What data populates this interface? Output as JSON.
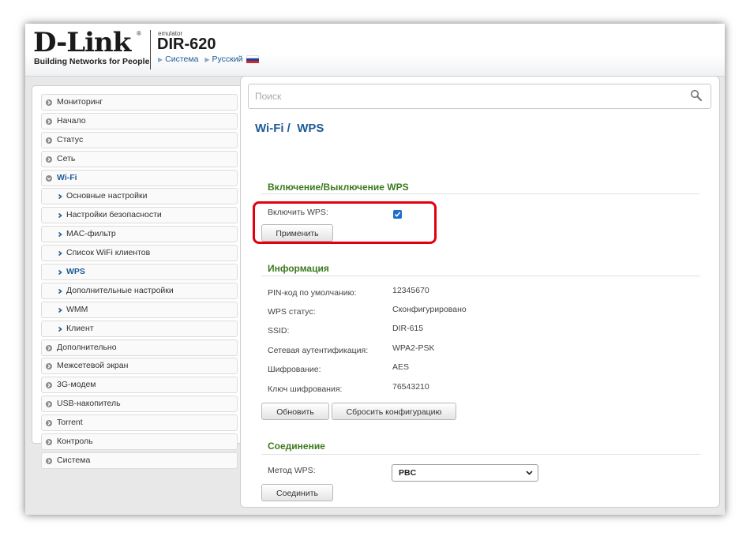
{
  "header": {
    "logo_text": "D-Link",
    "logo_reg": "®",
    "tagline": "Building Networks for People",
    "emulator_label": "emulator",
    "model": "DIR-620",
    "breadcrumb": [
      "Система",
      "Русский"
    ]
  },
  "sidebar": {
    "items": [
      {
        "label": "Мониторинг"
      },
      {
        "label": "Начало"
      },
      {
        "label": "Статус"
      },
      {
        "label": "Сеть"
      },
      {
        "label": "Wi-Fi"
      },
      {
        "label": "Основные настройки"
      },
      {
        "label": "Настройки безопасности"
      },
      {
        "label": "MAC-фильтр"
      },
      {
        "label": "Список WiFi клиентов"
      },
      {
        "label": "WPS"
      },
      {
        "label": "Дополнительные настройки"
      },
      {
        "label": "WMM"
      },
      {
        "label": "Клиент"
      },
      {
        "label": "Дополнительно"
      },
      {
        "label": "Межсетевой экран"
      },
      {
        "label": "3G-модем"
      },
      {
        "label": "USB-накопитель"
      },
      {
        "label": "Torrent"
      },
      {
        "label": "Контроль"
      },
      {
        "label": "Система"
      }
    ]
  },
  "search": {
    "placeholder": "Поиск"
  },
  "page": {
    "title": "Wi-Fi /  WPS"
  },
  "wps_toggle": {
    "section_title": "Включение/Выключение WPS",
    "enable_label": "Включить WPS:",
    "enable_checked": true,
    "apply_button": "Применить"
  },
  "info": {
    "section_title": "Информация",
    "rows": [
      {
        "label": "PIN-код по умолчанию:",
        "value": "12345670"
      },
      {
        "label": "WPS статус:",
        "value": "Сконфигурировано"
      },
      {
        "label": "SSID:",
        "value": "DIR-615"
      },
      {
        "label": "Сетевая аутентификация:",
        "value": "WPA2-PSK"
      },
      {
        "label": "Шифрование:",
        "value": "AES"
      },
      {
        "label": "Ключ шифрования:",
        "value": "76543210"
      }
    ],
    "refresh_button": "Обновить",
    "reset_button": "Сбросить конфигурацию"
  },
  "connection": {
    "section_title": "Соединение",
    "method_label": "Метод WPS:",
    "method_value": "PBC",
    "connect_button": "Соединить"
  },
  "colors": {
    "accent_blue": "#1e5a96",
    "section_green": "#3c7a1e",
    "highlight_red": "#e3000e",
    "checkbox_blue": "#1a6fd1"
  }
}
